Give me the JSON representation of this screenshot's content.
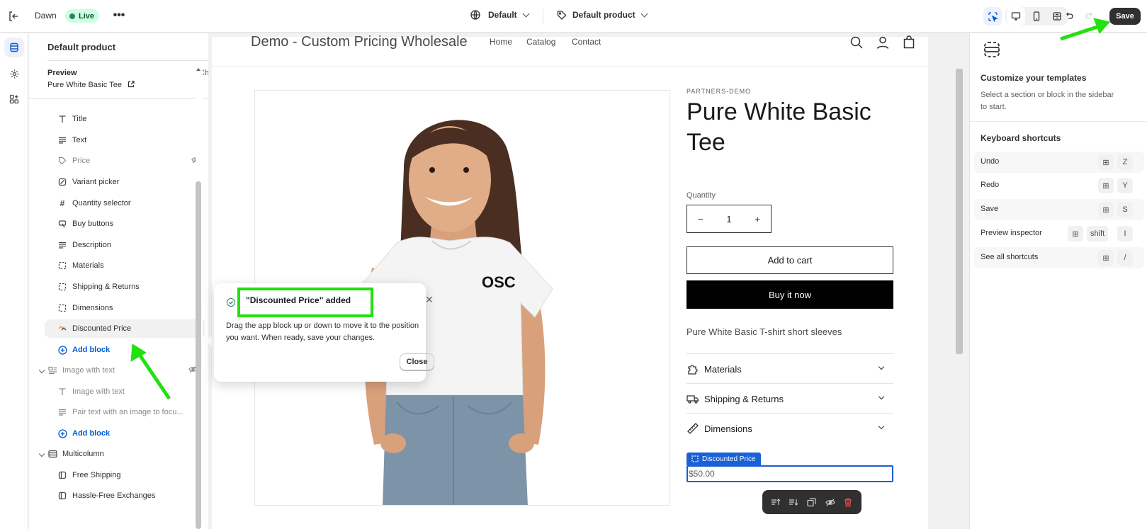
{
  "topbar": {
    "theme_name": "Dawn",
    "status_badge": "Live",
    "template_label": "Default",
    "product_label": "Default product",
    "save_label": "Save"
  },
  "sidebar": {
    "header": "Default product",
    "preview_label": "Preview",
    "change_label": "Change",
    "preview_product": "Pure White Basic Tee",
    "items": [
      {
        "label": "Title",
        "icon": "title-icon"
      },
      {
        "label": "Text",
        "icon": "text-icon"
      },
      {
        "label": "Price",
        "icon": "price-icon"
      },
      {
        "label": "Variant picker",
        "icon": "variant-icon"
      },
      {
        "label": "Quantity selector",
        "icon": "hash-icon"
      },
      {
        "label": "Buy buttons",
        "icon": "cart-icon"
      },
      {
        "label": "Description",
        "icon": "text-icon"
      },
      {
        "label": "Materials",
        "icon": "collapsible-icon"
      },
      {
        "label": "Shipping & Returns",
        "icon": "collapsible-icon"
      },
      {
        "label": "Dimensions",
        "icon": "collapsible-icon"
      },
      {
        "label": "Discounted Price",
        "icon": "app-block-icon"
      },
      {
        "label": "Add block",
        "icon": "plus-circle-icon"
      }
    ],
    "sections": [
      {
        "label": "Image with text",
        "icon": "image-text-icon",
        "items": [
          {
            "label": "Image with text",
            "icon": "title-icon"
          },
          {
            "label": "Pair text with an image to focu...",
            "icon": "text-icon"
          },
          {
            "label": "Add block",
            "icon": "plus-circle-icon"
          }
        ]
      },
      {
        "label": "Multicolumn",
        "icon": "multicolumn-icon",
        "items": [
          {
            "label": "Free Shipping",
            "icon": "column-icon"
          },
          {
            "label": "Hassle-Free Exchanges",
            "icon": "column-icon"
          }
        ]
      }
    ]
  },
  "popover": {
    "title": "\"Discounted Price\" added",
    "body": "Drag the app block up or down to move it to the position you want. When ready, save your changes.",
    "close_label": "Close"
  },
  "store": {
    "title": "Demo - Custom Pricing Wholesale",
    "nav": [
      "Home",
      "Catalog",
      "Contact"
    ],
    "vendor": "PARTNERS-DEMO",
    "product_title": "Pure White Basic Tee",
    "quantity_label": "Quantity",
    "quantity_value": "1",
    "add_to_cart": "Add to cart",
    "buy_now": "Buy it now",
    "description": "Pure White Basic T-shirt short sleeves",
    "accordions": [
      "Materials",
      "Shipping & Returns",
      "Dimensions"
    ],
    "block_tag": "Discounted Price",
    "discounted_price": "$50.00",
    "shirt_logo": "OSC"
  },
  "right_panel": {
    "title": "Customize your templates",
    "subtitle": "Select a section or block in the sidebar to start.",
    "shortcuts_title": "Keyboard shortcuts",
    "shortcuts": [
      {
        "label": "Undo",
        "keys": [
          "⊞",
          "Z"
        ]
      },
      {
        "label": "Redo",
        "keys": [
          "⊞",
          "Y"
        ]
      },
      {
        "label": "Save",
        "keys": [
          "⊞",
          "S"
        ]
      },
      {
        "label": "Preview inspector",
        "keys": [
          "⊞",
          "shift",
          "I"
        ]
      },
      {
        "label": "See all shortcuts",
        "keys": [
          "⊞",
          "/"
        ]
      }
    ]
  },
  "colors": {
    "accent_blue": "#005bd3",
    "highlight_green": "#22e10e",
    "live_green": "#29845a",
    "block_blue": "#1a60d6"
  }
}
